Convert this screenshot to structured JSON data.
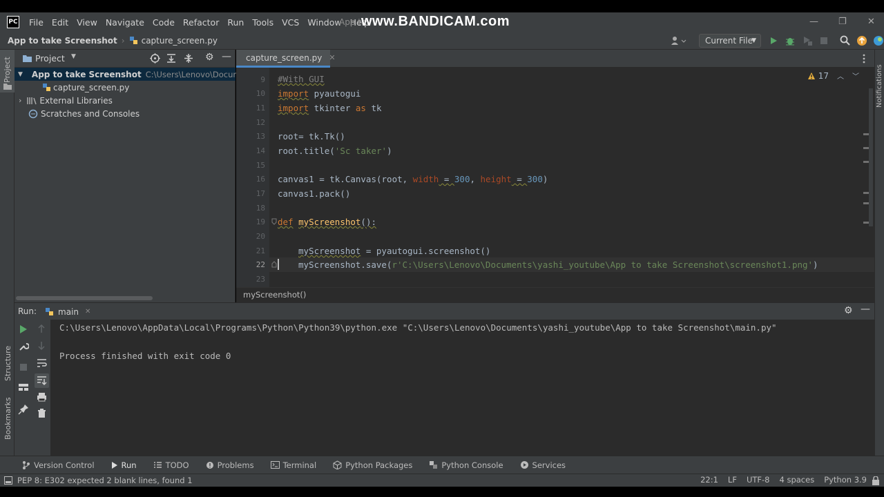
{
  "window": {
    "title_partial": "App to",
    "watermark": "www.BANDICAM.com",
    "logo": "PC"
  },
  "menu": [
    "File",
    "Edit",
    "View",
    "Navigate",
    "Code",
    "Refactor",
    "Run",
    "Tools",
    "VCS",
    "Window",
    "Help"
  ],
  "navbar": {
    "project_name": "App to take Screenshot",
    "file_name": "capture_screen.py",
    "run_config": "Current File"
  },
  "left_stripe": {
    "project_label": "Project",
    "structure_label": "Structure",
    "bookmarks_label": "Bookmarks"
  },
  "right_stripe": {
    "notifications_label": "Notifications"
  },
  "project_panel": {
    "title": "Project",
    "root": {
      "name": "App to take Screenshot",
      "path": "C:\\Users\\Lenovo\\Documents\\y"
    },
    "file": "capture_screen.py",
    "external": "External Libraries",
    "scratches": "Scratches and Consoles"
  },
  "editor": {
    "tab_label": "capture_screen.py",
    "inspection_count": "17",
    "breadcrumb_function": "myScreenshot()",
    "line_numbers": [
      "9",
      "10",
      "11",
      "12",
      "13",
      "14",
      "15",
      "16",
      "17",
      "18",
      "19",
      "20",
      "21",
      "22",
      "23"
    ],
    "code": {
      "l9": "#With GUI",
      "l10_kw": "import",
      "l10_rest": " pyautogui",
      "l11_kw": "import",
      "l11_mid": " tkinter ",
      "l11_as": "as",
      "l11_rest": " tk",
      "l13": "root= tk.Tk()",
      "l14_a": "root.title(",
      "l14_str": "'Sc taker'",
      "l14_b": ")",
      "l16_a": "canvas1 = tk.Canvas(root, ",
      "l16_p1": "width",
      "l16_eq1": " = ",
      "l16_n1": "300",
      "l16_c": ", ",
      "l16_p2": "height",
      "l16_eq2": " = ",
      "l16_n2": "300",
      "l16_b": ")",
      "l17": "canvas1.pack()",
      "l19_kw": "def",
      "l19_fn": "myScreenshot",
      "l19_rest": "():",
      "l21_var": "myScreenshot",
      "l21_rest": " = pyautogui.screenshot()",
      "l22_a": "myScreenshot.save(",
      "l22_str": "r'C:\\Users\\Lenovo\\Documents\\yashi_youtube\\App to take Screenshot\\screenshot1.png'",
      "l22_b": ")"
    }
  },
  "run_panel": {
    "label": "Run:",
    "config": "main",
    "command": "C:\\Users\\Lenovo\\AppData\\Local\\Programs\\Python\\Python39\\python.exe \"C:\\Users\\Lenovo\\Documents\\yashi_youtube\\App to take Screenshot\\main.py\"",
    "exit_message": "Process finished with exit code 0"
  },
  "tool_windows": [
    {
      "label": "Version Control",
      "icon": "branch-icon"
    },
    {
      "label": "Run",
      "icon": "play-icon"
    },
    {
      "label": "TODO",
      "icon": "list-icon"
    },
    {
      "label": "Problems",
      "icon": "problems-icon"
    },
    {
      "label": "Terminal",
      "icon": "terminal-icon"
    },
    {
      "label": "Python Packages",
      "icon": "packages-icon"
    },
    {
      "label": "Python Console",
      "icon": "python-icon"
    },
    {
      "label": "Services",
      "icon": "services-icon"
    }
  ],
  "status": {
    "message": "PEP 8: E302 expected 2 blank lines, found 1",
    "position": "22:1",
    "line_sep": "LF",
    "encoding": "UTF-8",
    "indent": "4 spaces",
    "interpreter": "Python 3.9"
  },
  "colors": {
    "background": "#2b2b2b",
    "panel": "#3c3f41",
    "keyword": "#cc7832",
    "string": "#6a8759",
    "number": "#6897bb",
    "function": "#ffc66d",
    "accent": "#4a88c7"
  }
}
